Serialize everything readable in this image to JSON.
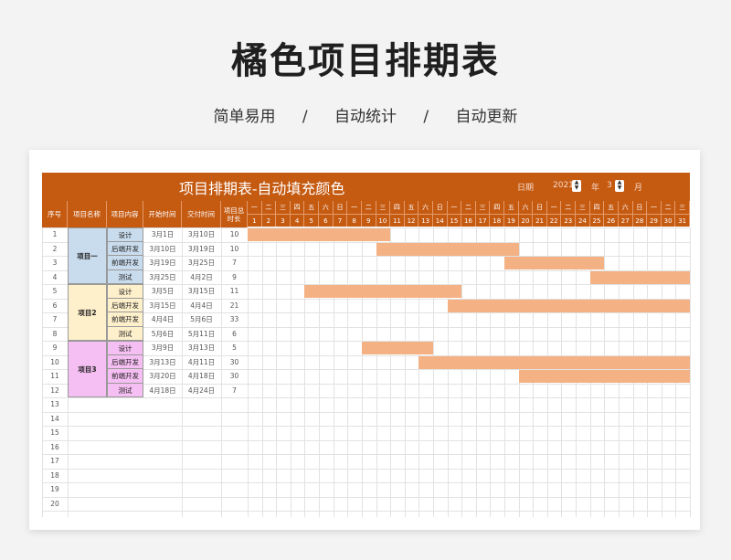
{
  "hero": {
    "title": "橘色项目排期表",
    "subtitle": [
      "简单易用",
      "/",
      "自动统计",
      "/",
      "自动更新"
    ]
  },
  "sheet": {
    "title": "项目排期表-自动填充颜色",
    "date_label": "日期",
    "year": "2021",
    "year_unit": "年",
    "month": "3",
    "month_unit": "月",
    "columns": [
      "序号",
      "项目名称",
      "项目内容",
      "开始时间",
      "交付时间",
      "项目总\n时长"
    ],
    "weekdays": [
      "一",
      "二",
      "三",
      "四",
      "五",
      "六",
      "日",
      "一",
      "二",
      "三",
      "四",
      "五",
      "六",
      "日",
      "一",
      "二",
      "三",
      "四",
      "五",
      "六",
      "日",
      "一",
      "二",
      "三",
      "四",
      "五",
      "六",
      "日",
      "一",
      "二",
      "三"
    ],
    "days": [
      "1",
      "2",
      "3",
      "4",
      "5",
      "6",
      "7",
      "8",
      "9",
      "10",
      "11",
      "12",
      "13",
      "14",
      "15",
      "16",
      "17",
      "18",
      "19",
      "20",
      "21",
      "22",
      "23",
      "24",
      "25",
      "26",
      "27",
      "28",
      "29",
      "30",
      "31"
    ],
    "projects": [
      {
        "name": "项目一",
        "color": "#c9dcee"
      },
      {
        "name": "项目2",
        "color": "#fff0cc"
      },
      {
        "name": "项目3",
        "color": "#f6bff3"
      }
    ],
    "rows": [
      {
        "no": "1",
        "task": "设计",
        "start": "3月1日",
        "end": "3月10日",
        "dur": "10",
        "s": 1,
        "e": 10
      },
      {
        "no": "2",
        "task": "后端开发",
        "start": "3月10日",
        "end": "3月19日",
        "dur": "10",
        "s": 10,
        "e": 19
      },
      {
        "no": "3",
        "task": "前端开发",
        "start": "3月19日",
        "end": "3月25日",
        "dur": "7",
        "s": 19,
        "e": 25
      },
      {
        "no": "4",
        "task": "测试",
        "start": "3月25日",
        "end": "4月2日",
        "dur": "9",
        "s": 25,
        "e": 31
      },
      {
        "no": "5",
        "task": "设计",
        "start": "3月5日",
        "end": "3月15日",
        "dur": "11",
        "s": 5,
        "e": 15
      },
      {
        "no": "6",
        "task": "后端开发",
        "start": "3月15日",
        "end": "4月4日",
        "dur": "21",
        "s": 15,
        "e": 31
      },
      {
        "no": "7",
        "task": "前端开发",
        "start": "4月4日",
        "end": "5月6日",
        "dur": "33",
        "s": 0,
        "e": 0
      },
      {
        "no": "8",
        "task": "测试",
        "start": "5月6日",
        "end": "5月11日",
        "dur": "6",
        "s": 0,
        "e": 0
      },
      {
        "no": "9",
        "task": "设计",
        "start": "3月9日",
        "end": "3月13日",
        "dur": "5",
        "s": 9,
        "e": 13
      },
      {
        "no": "10",
        "task": "后端开发",
        "start": "3月13日",
        "end": "4月11日",
        "dur": "30",
        "s": 13,
        "e": 31
      },
      {
        "no": "11",
        "task": "前端开发",
        "start": "3月20日",
        "end": "4月18日",
        "dur": "30",
        "s": 20,
        "e": 31
      },
      {
        "no": "12",
        "task": "测试",
        "start": "4月18日",
        "end": "4月24日",
        "dur": "7",
        "s": 0,
        "e": 0
      }
    ],
    "empty_rows": [
      "13",
      "14",
      "15",
      "16",
      "17",
      "18",
      "19",
      "20"
    ]
  }
}
